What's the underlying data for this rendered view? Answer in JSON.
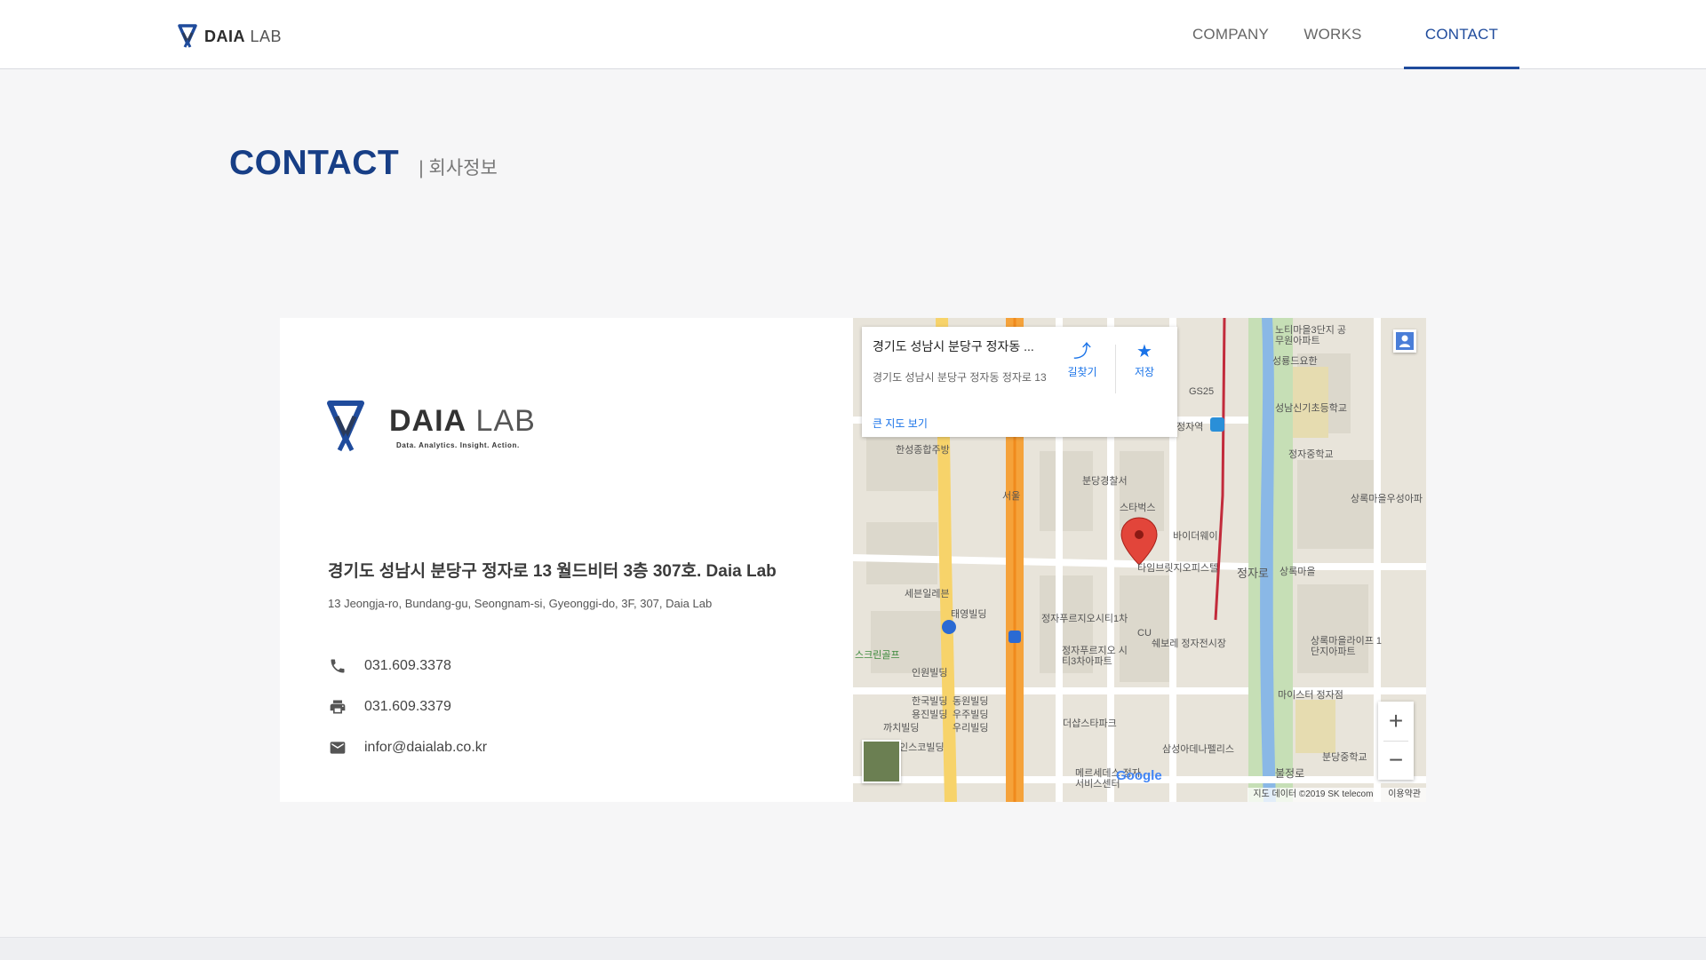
{
  "header": {
    "logo": {
      "bold": "DAIA",
      "light": " LAB"
    },
    "nav": [
      {
        "label": "COMPANY",
        "active": false
      },
      {
        "label": "WORKS",
        "active": false
      },
      {
        "label": "CONTACT",
        "active": true
      }
    ]
  },
  "page": {
    "title": "CONTACT",
    "subtitle": "| 회사정보"
  },
  "card": {
    "logo": {
      "bold": "DAIA",
      "light": " LAB",
      "tagline": "Data. Analytics. Insight. Action."
    },
    "address_ko": "경기도 성남시 분당구 정자로 13 월드비터 3층 307호. Daia Lab",
    "address_en": "13 Jeongja-ro, Bundang-gu, Seongnam-si, Gyeonggi-do, 3F, 307, Daia Lab",
    "phone": "031.609.3378",
    "fax": "031.609.3379",
    "email": "infor@daialab.co.kr"
  },
  "map": {
    "info": {
      "title": "경기도 성남시 분당구 정자동 ...",
      "address": "경기도 성남시 분당구 정자동 정자로 13",
      "directions": "길찾기",
      "save": "저장",
      "large_map": "큰 지도 보기"
    },
    "labels": [
      "노티마을3단지 공무원아파트",
      "성룡드요한",
      "성남신기초등학교",
      "정자중학교",
      "상록마을우성아파",
      "한성종합주방",
      "분당경찰서",
      "스타벅스",
      "바이더웨이",
      "타임브릿지오피스텔",
      "정자로",
      "상록마을",
      "세븐일레븐",
      "태영빌딩",
      "정자푸르지오시티1차",
      "쉐보레 정자전시장",
      "상록마을라이프 1단지아파트",
      "스크린골프",
      "인원빌딩",
      "정자푸르지오 시티3차아파트",
      "마이스터 정자점",
      "한국빌딩",
      "동원빌딩",
      "용진빌딩",
      "우주빌딩",
      "까치빌딩",
      "우리빌딩",
      "더샵스타파크",
      "인스코빌딩",
      "삼성아데나펠리스",
      "분당중학교",
      "불정로",
      "메르세데스 정자서비스센터",
      "정자역",
      "서울",
      "GS25",
      "CU"
    ],
    "attribution": "지도 데이터 ©2019 SK telecom",
    "terms": "이용약관",
    "google": "Google",
    "zoom_in": "+",
    "zoom_out": "−"
  }
}
